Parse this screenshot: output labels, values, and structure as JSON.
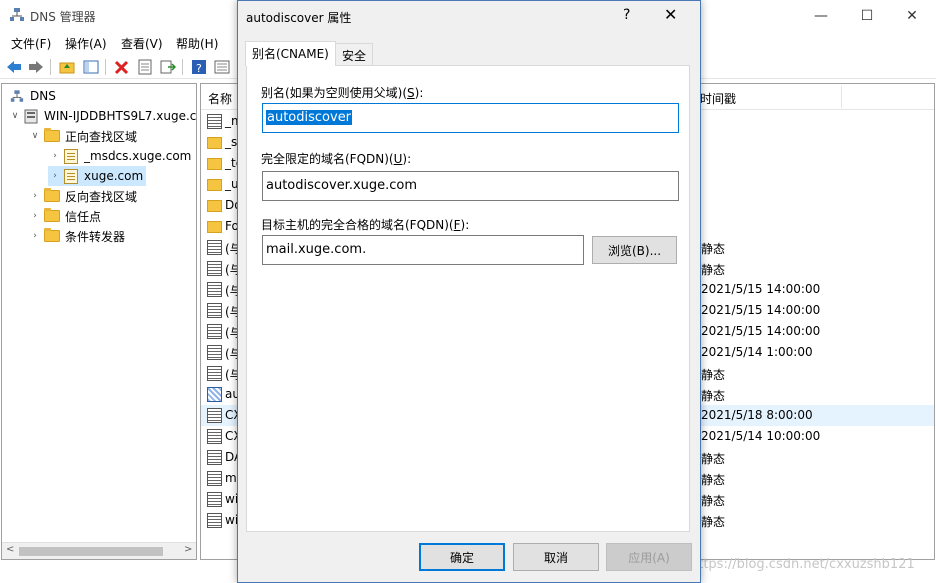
{
  "main": {
    "title": "DNS 管理器",
    "menu": [
      "文件(F)",
      "操作(A)",
      "查看(V)",
      "帮助(H)"
    ],
    "tree": {
      "root": "DNS",
      "server": "WIN-IJDDBHTS9L7.xuge.c",
      "forward": "正向查找区域",
      "msdcs": "_msdcs.xuge.com",
      "zone": "xuge.com",
      "reverse": "反向查找区域",
      "trust": "信任点",
      "forwarders": "条件转发器"
    },
    "list": {
      "col_name": "名称",
      "col_timestamp": "时间戳",
      "rows": [
        {
          "name": "_m",
          "icon": "record",
          "ts": ""
        },
        {
          "name": "_s",
          "icon": "folder",
          "ts": ""
        },
        {
          "name": "_tc",
          "icon": "folder",
          "ts": ""
        },
        {
          "name": "_u",
          "icon": "folder",
          "ts": ""
        },
        {
          "name": "Do",
          "icon": "folder",
          "ts": ""
        },
        {
          "name": "Fo",
          "icon": "folder",
          "ts": ""
        },
        {
          "name": "(与",
          "icon": "record",
          "ts": "静态"
        },
        {
          "name": "(与",
          "icon": "record",
          "ts": "静态"
        },
        {
          "name": "(与",
          "icon": "record",
          "ts": "2021/5/15 14:00:00"
        },
        {
          "name": "(与",
          "icon": "record",
          "ts": "2021/5/15 14:00:00"
        },
        {
          "name": "(与",
          "icon": "record",
          "ts": "2021/5/15 14:00:00"
        },
        {
          "name": "(与",
          "icon": "record",
          "ts": "2021/5/14 1:00:00"
        },
        {
          "name": "(与",
          "icon": "record",
          "ts": "静态"
        },
        {
          "name": "au",
          "icon": "alias",
          "ts": "静态"
        },
        {
          "name": "CX",
          "icon": "record",
          "ts": "2021/5/18 8:00:00"
        },
        {
          "name": "CX",
          "icon": "record",
          "ts": "2021/5/14 10:00:00"
        },
        {
          "name": "DA",
          "icon": "record",
          "ts": "静态"
        },
        {
          "name": "m",
          "icon": "record",
          "ts": "静态"
        },
        {
          "name": "wi",
          "icon": "record",
          "ts": "静态"
        },
        {
          "name": "wi",
          "icon": "record",
          "ts": "静态"
        }
      ]
    },
    "watermark": "https://blog.csdn.net/cxxuzshb121"
  },
  "dialog": {
    "title": "autodiscover 属性",
    "help": "?",
    "close": "✕",
    "tabs": [
      "别名(CNAME)",
      "安全"
    ],
    "alias_label": "别名(如果为空则使用父域)(",
    "alias_key": "S",
    "alias_value": "autodiscover",
    "fqdn_label": "完全限定的域名(FQDN)(",
    "fqdn_key": "U",
    "fqdn_value": "autodiscover.xuge.com",
    "target_label": "目标主机的完全合格的域名(FQDN)(",
    "target_key": "F",
    "target_value": "mail.xuge.com.",
    "browse": "浏览(B)...",
    "ok": "确定",
    "cancel": "取消",
    "apply": "应用(A)"
  }
}
